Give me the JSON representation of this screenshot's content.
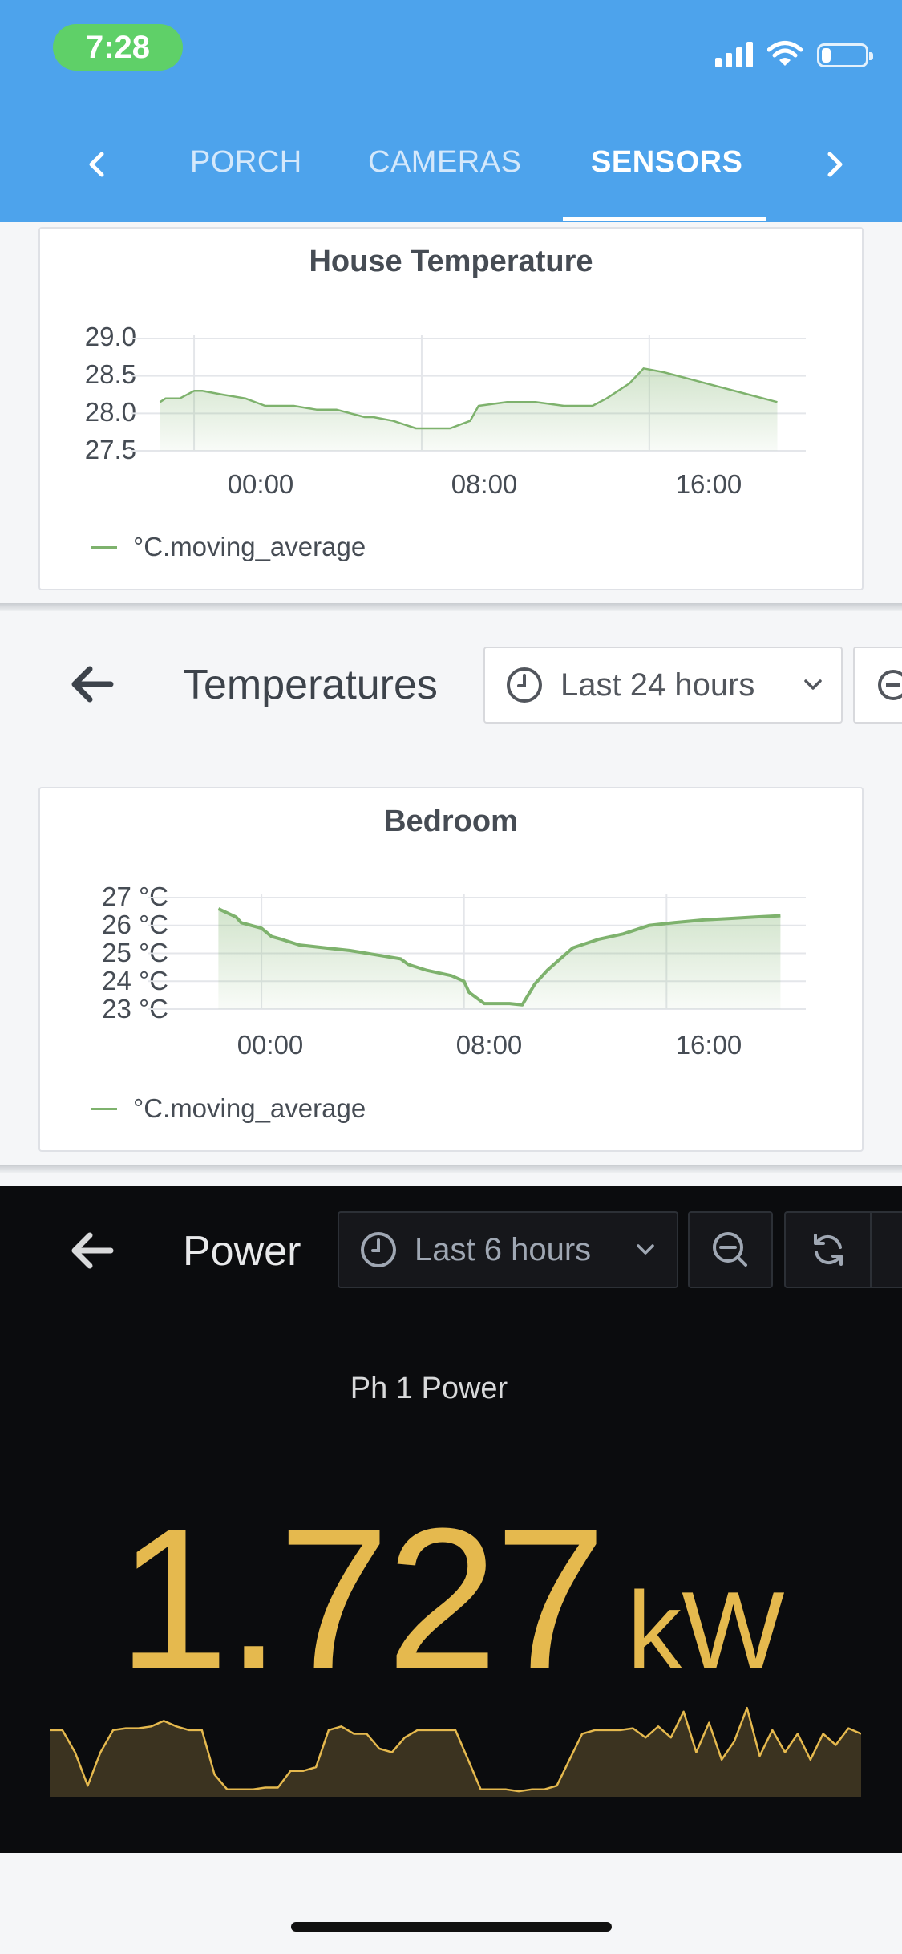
{
  "status_bar": {
    "time": "7:28",
    "battery_level": 0.22
  },
  "tabs": {
    "items": [
      {
        "label": "PORCH",
        "active": false
      },
      {
        "label": "CAMERAS",
        "active": false
      },
      {
        "label": "SENSORS",
        "active": true
      }
    ]
  },
  "house_panel": {
    "title": "House Temperature",
    "legend": "°C.moving_average",
    "y_ticks": [
      "29.0",
      "28.5",
      "28.0",
      "27.5"
    ],
    "x_ticks": [
      "00:00",
      "08:00",
      "16:00"
    ]
  },
  "temperatures_dashboard": {
    "title": "Temperatures",
    "time_range": "Last 24 hours"
  },
  "bedroom_panel": {
    "title": "Bedroom",
    "legend": "°C.moving_average",
    "y_ticks": [
      "27 °C",
      "26 °C",
      "25 °C",
      "24 °C",
      "23 °C"
    ],
    "x_ticks": [
      "00:00",
      "08:00",
      "16:00"
    ]
  },
  "power_dashboard": {
    "title": "Power",
    "time_range": "Last 6 hours",
    "panel_title": "Ph 1 Power",
    "value": "1.727",
    "unit": "kW"
  },
  "colors": {
    "accent_blue": "#4da3ec",
    "series_green": "#7eb26d",
    "power_yellow": "#e5b94e",
    "dark_bg": "#0b0c0e"
  },
  "chart_data": [
    {
      "type": "area",
      "title": "House Temperature",
      "series": [
        {
          "name": "°C.moving_average",
          "x": [
            -1.2,
            -1.0,
            -0.5,
            0.0,
            0.3,
            1.0,
            1.8,
            2.5,
            3.5,
            4.3,
            5.0,
            6.0,
            6.3,
            7.0,
            7.8,
            8.2,
            9.0,
            9.7,
            10.0,
            11.0,
            12.0,
            13.0,
            14.0,
            14.5,
            15.3,
            15.8,
            16.5,
            17.5,
            18.5,
            19.5,
            20.5
          ],
          "values": [
            28.15,
            28.2,
            28.2,
            28.3,
            28.3,
            28.25,
            28.2,
            28.1,
            28.1,
            28.05,
            28.05,
            27.95,
            27.95,
            27.9,
            27.8,
            27.8,
            27.8,
            27.9,
            28.1,
            28.15,
            28.15,
            28.1,
            28.1,
            28.2,
            28.4,
            28.6,
            28.55,
            28.45,
            28.35,
            28.25,
            28.15
          ]
        }
      ],
      "x_unit": "hours",
      "ylim": [
        27.5,
        29.0
      ],
      "xlim": [
        -2.2,
        21.5
      ],
      "grid": true,
      "legend_position": "bottom-left"
    },
    {
      "type": "area",
      "title": "Bedroom",
      "series": [
        {
          "name": "°C.moving_average",
          "x": [
            -1.7,
            -1.0,
            -0.8,
            0.0,
            0.4,
            0.8,
            1.5,
            2.5,
            3.5,
            4.5,
            5.5,
            5.8,
            6.5,
            7.5,
            8.0,
            8.2,
            8.8,
            9.3,
            9.8,
            10.3,
            10.8,
            11.3,
            11.8,
            12.3,
            13.3,
            14.3,
            15.3,
            16.3,
            17.5,
            18.5,
            19.5,
            20.5
          ],
          "values": [
            26.6,
            26.3,
            26.1,
            25.9,
            25.6,
            25.5,
            25.3,
            25.2,
            25.1,
            24.95,
            24.8,
            24.6,
            24.4,
            24.2,
            24.0,
            23.6,
            23.2,
            23.2,
            23.2,
            23.15,
            23.9,
            24.4,
            24.8,
            25.2,
            25.5,
            25.7,
            26.0,
            26.1,
            26.2,
            26.25,
            26.3,
            26.35
          ]
        }
      ],
      "x_unit": "hours",
      "ylim": [
        23,
        27
      ],
      "xlim": [
        -4.5,
        21.5
      ],
      "grid": true,
      "legend_position": "bottom-left"
    },
    {
      "type": "area",
      "title": "Ph 1 Power",
      "series": [
        {
          "name": "Ph 1 Power",
          "values": [
            1.8,
            1.8,
            1.2,
            0.3,
            1.2,
            1.8,
            1.85,
            1.85,
            1.9,
            2.05,
            1.9,
            1.8,
            1.8,
            0.6,
            0.2,
            0.2,
            0.2,
            0.25,
            0.25,
            0.7,
            0.7,
            0.8,
            1.8,
            1.9,
            1.7,
            1.7,
            1.3,
            1.2,
            1.6,
            1.8,
            1.8,
            1.8,
            1.8,
            1.0,
            0.2,
            0.2,
            0.2,
            0.15,
            0.2,
            0.2,
            0.3,
            1.0,
            1.7,
            1.8,
            1.8,
            1.8,
            1.85,
            1.6,
            1.9,
            1.6,
            2.3,
            1.2,
            2.0,
            1.0,
            1.5,
            2.4,
            1.1,
            1.8,
            1.2,
            1.7,
            1.0,
            1.7,
            1.4,
            1.85,
            1.7
          ]
        }
      ],
      "ylim": [
        0,
        2.6
      ]
    }
  ]
}
